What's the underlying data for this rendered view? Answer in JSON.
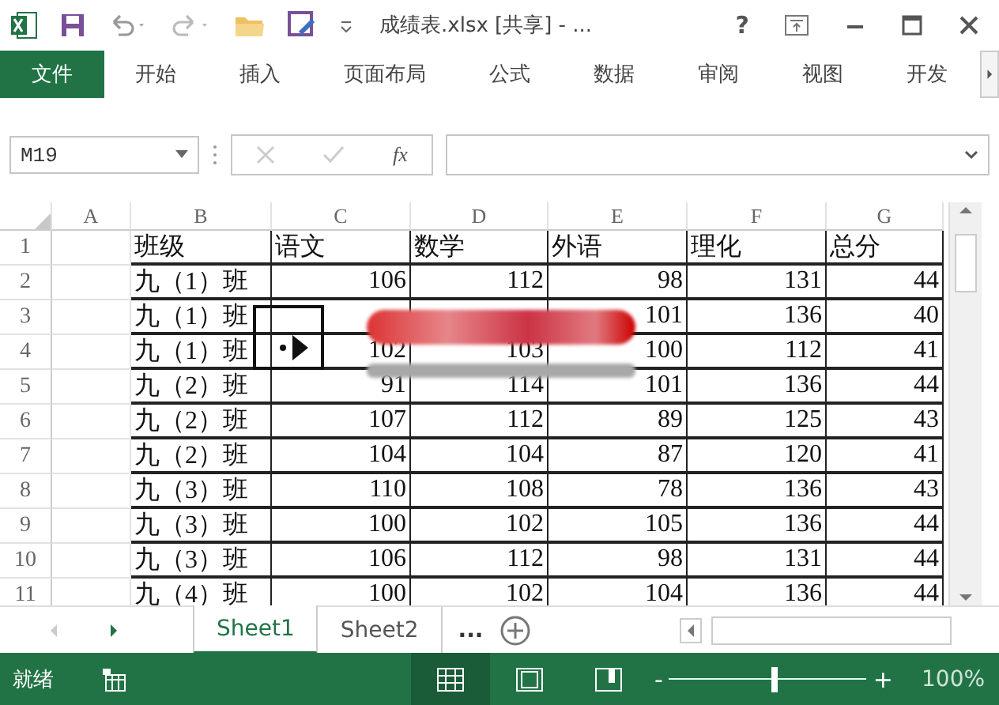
{
  "window": {
    "title": "成绩表.xlsx  [共享] - ..."
  },
  "ribbon_tabs": [
    {
      "label": "文件",
      "kind": "file"
    },
    {
      "label": "开始",
      "kind": "tab"
    },
    {
      "label": "插入",
      "kind": "tab"
    },
    {
      "label": "页面布局",
      "kind": "tab"
    },
    {
      "label": "公式",
      "kind": "tab"
    },
    {
      "label": "数据",
      "kind": "tab"
    },
    {
      "label": "审阅",
      "kind": "tab"
    },
    {
      "label": "视图",
      "kind": "tab"
    },
    {
      "label": "开发",
      "kind": "tab"
    }
  ],
  "title_bar": {
    "help": "?"
  },
  "formula_bar": {
    "name_box": "M19",
    "fx": "fx"
  },
  "table": {
    "columns": [
      "A",
      "B",
      "C",
      "D",
      "E",
      "F",
      "G"
    ],
    "rows": [
      {
        "number": "1",
        "cells": [
          "",
          "班级",
          "语文",
          "数学",
          "外语",
          "理化",
          "总分"
        ],
        "kind": "header"
      },
      {
        "number": "2",
        "cells": [
          "",
          "九（1）班",
          "106",
          "112",
          "98",
          "131",
          "44"
        ],
        "kind": "data"
      },
      {
        "number": "3",
        "cells": [
          "",
          "九（1）班",
          null,
          null,
          "101",
          "136",
          "40"
        ],
        "kind": "data"
      },
      {
        "number": "4",
        "cells": [
          "",
          "九（1）班",
          "102",
          "103",
          "100",
          "112",
          "41"
        ],
        "kind": "data"
      },
      {
        "number": "5",
        "cells": [
          "",
          "九（2）班",
          "91",
          "114",
          "101",
          "136",
          "44"
        ],
        "kind": "data"
      },
      {
        "number": "6",
        "cells": [
          "",
          "九（2）班",
          "107",
          "112",
          "89",
          "125",
          "43"
        ],
        "kind": "data"
      },
      {
        "number": "7",
        "cells": [
          "",
          "九（2）班",
          "104",
          "104",
          "87",
          "120",
          "41"
        ],
        "kind": "data"
      },
      {
        "number": "8",
        "cells": [
          "",
          "九（3）班",
          "110",
          "108",
          "78",
          "136",
          "43"
        ],
        "kind": "data"
      },
      {
        "number": "9",
        "cells": [
          "",
          "九（3）班",
          "100",
          "102",
          "105",
          "136",
          "44"
        ],
        "kind": "data"
      },
      {
        "number": "10",
        "cells": [
          "",
          "九（3）班",
          "106",
          "112",
          "98",
          "131",
          "44"
        ],
        "kind": "data"
      },
      {
        "number": "11",
        "cells": [
          "",
          "九（4）班",
          "100",
          "102",
          "104",
          "136",
          "44"
        ],
        "kind": "data"
      }
    ]
  },
  "sheet_tabs": [
    {
      "label": "Sheet1",
      "selected": true
    },
    {
      "label": "Sheet2",
      "selected": false
    }
  ],
  "sheet_more": "...",
  "status_bar": {
    "status": "就绪",
    "zoom_minus": "-",
    "zoom_plus": "+",
    "zoom": "100%",
    "zoom_slider": {
      "level": 0.53
    }
  }
}
